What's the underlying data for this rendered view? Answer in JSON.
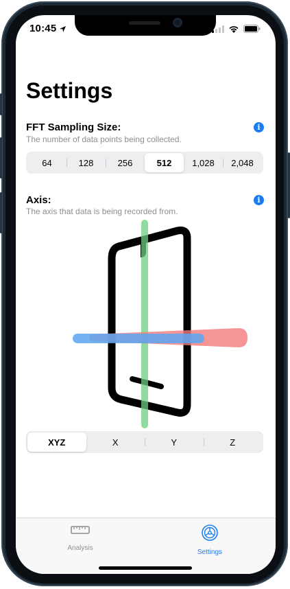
{
  "status_bar": {
    "time": "10:45"
  },
  "page": {
    "title": "Settings"
  },
  "fft": {
    "label": "FFT Sampling Size:",
    "description": "The number of data points being collected.",
    "options": [
      "64",
      "128",
      "256",
      "512",
      "1,028",
      "2,048"
    ],
    "selected": "512"
  },
  "axis": {
    "label": "Axis:",
    "description": "The axis that data is being recorded from.",
    "options": [
      "XYZ",
      "X",
      "Y",
      "Z"
    ],
    "selected": "XYZ",
    "illustration_colors": {
      "x_axis": "#f47b7a",
      "y_axis": "#6bd07e",
      "z_axis": "#5aa6f2"
    }
  },
  "tabbar": {
    "tabs": [
      {
        "label": "Analysis",
        "icon": "ruler-icon",
        "active": false
      },
      {
        "label": "Settings",
        "icon": "gear-icon",
        "active": true
      }
    ]
  },
  "colors": {
    "accent": "#1a7cf5",
    "inactive_tab": "#8e8e93"
  }
}
